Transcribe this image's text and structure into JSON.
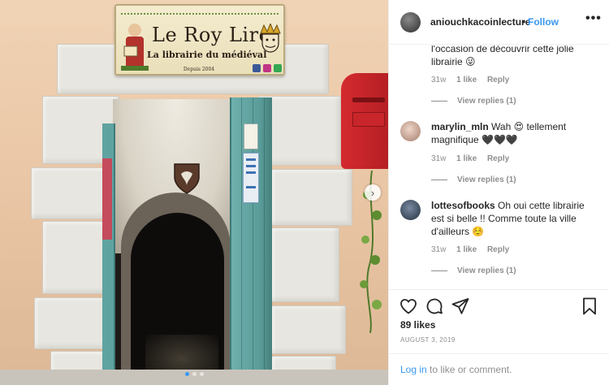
{
  "photo": {
    "sign": {
      "title": "Le Roy Lire",
      "subtitle": "La librairie du médiéval",
      "since": "Depuis 2004"
    },
    "next_icon": "chevron-right-icon",
    "carousel_slides": 3,
    "carousel_active": 1
  },
  "header": {
    "username": "aniouchkacoinlecture",
    "separator": "•",
    "follow_label": "Follow",
    "more_icon": "more-options-icon"
  },
  "comments": [
    {
      "username": "",
      "text": "l'occasion de découvrir cette jolie librairie 😜",
      "age": "31w",
      "likes": "1 like",
      "reply_label": "Reply",
      "view_replies": "View replies (1)"
    },
    {
      "username": "marylin_mln",
      "text": "Wah 😍 tellement magnifique 🖤🖤🖤",
      "age": "31w",
      "likes": "1 like",
      "reply_label": "Reply",
      "view_replies": "View replies (1)"
    },
    {
      "username": "lottesofbooks",
      "text": "Oh oui cette librairie est si belle !! Comme toute la ville d'ailleurs ☺️",
      "age": "31w",
      "likes": "1 like",
      "reply_label": "Reply",
      "view_replies": "View replies (1)"
    }
  ],
  "actions": {
    "like_icon": "heart-icon",
    "comment_icon": "comment-icon",
    "share_icon": "share-icon",
    "save_icon": "bookmark-icon",
    "likes_count": "89 likes",
    "date": "AUGUST 3, 2019",
    "login_link": "Log in",
    "login_rest": " to like or comment."
  },
  "colors": {
    "accent": "#3897f0",
    "text": "#262626",
    "muted": "#8e8e8e",
    "divider": "#efefef"
  }
}
